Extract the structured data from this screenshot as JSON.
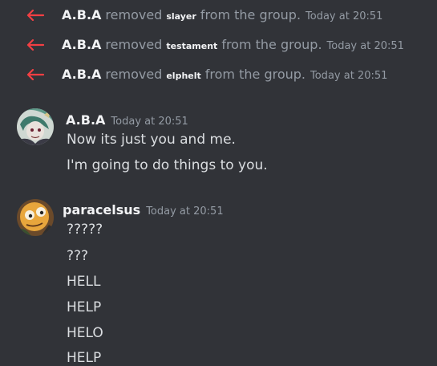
{
  "system_messages": [
    {
      "user": "A.B.A",
      "verb": "removed",
      "target": "slayer",
      "tail": "from the group.",
      "time": "Today at 20:51"
    },
    {
      "user": "A.B.A",
      "verb": "removed",
      "target": "testament",
      "tail": "from the group.",
      "time": "Today at 20:51"
    },
    {
      "user": "A.B.A",
      "verb": "removed",
      "target": "elphelt",
      "tail": "from the group.",
      "time": "Today at 20:51"
    }
  ],
  "messages": [
    {
      "author": "A.B.A",
      "time": "Today at 20:51",
      "lines": [
        "Now its just you and me.",
        "I'm going to do things to you."
      ]
    },
    {
      "author": "paracelsus",
      "time": "Today at 20:51",
      "lines": [
        "?????",
        "???",
        "HELL",
        "HELP",
        "HELO",
        "HELP"
      ]
    }
  ],
  "colors": {
    "background": "#313338",
    "arrow": "#f23f43",
    "username": "#f2f3f5",
    "muted": "#949ba4",
    "text": "#dbdee1"
  },
  "icons": {
    "system_arrow": "arrow-left-icon",
    "avatar_aba": "avatar-aba",
    "avatar_paracelsus": "avatar-paracelsus"
  }
}
